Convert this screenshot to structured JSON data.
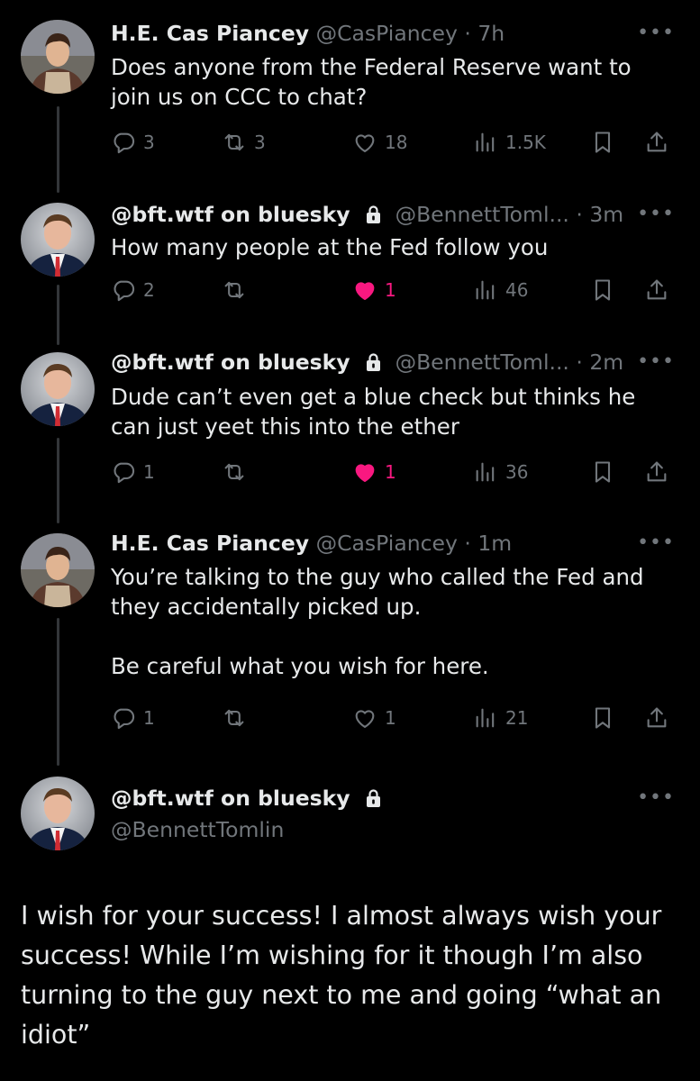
{
  "tweets": [
    {
      "name": "H.E. Cas Piancey",
      "handle": "@CasPiancey",
      "time": "· 7h",
      "text": "Does anyone from the Federal Reserve want to join us on CCC to chat?",
      "replies": "3",
      "reposts": "3",
      "likes": "18",
      "views": "1.5K",
      "liked": false,
      "avatar": "kid"
    },
    {
      "name": "@bft.wtf on bluesky",
      "handle": "@BennettToml...",
      "time": "· 3m",
      "text": "How many people at the Fed follow you",
      "replies": "2",
      "reposts": "",
      "likes": "1",
      "views": "46",
      "liked": true,
      "avatar": "suit"
    },
    {
      "name": "@bft.wtf on bluesky",
      "handle": "@BennettToml...",
      "time": "· 2m",
      "text": "Dude can’t even get a blue check but thinks he can just yeet this into the ether",
      "replies": "1",
      "reposts": "",
      "likes": "1",
      "views": "36",
      "liked": true,
      "avatar": "suit"
    },
    {
      "name": "H.E. Cas Piancey",
      "handle": "@CasPiancey",
      "time": "· 1m",
      "text": "You’re talking to the guy who called the Fed and they accidentally picked up.\n\nBe careful what you wish for here.",
      "replies": "1",
      "reposts": "",
      "likes": "1",
      "views": "21",
      "liked": false,
      "avatar": "kid"
    }
  ],
  "main_tweet": {
    "name": "@bft.wtf on bluesky",
    "handle": "@BennettTomlin",
    "text": "I wish for your success! I almost always wish your success! While I’m wishing for it though I’m also turning to the guy next to me and going “what an idiot”"
  },
  "more_label": "•••",
  "colors": {
    "background": "#000000",
    "text": "#e7e9ea",
    "muted": "#71767b",
    "like": "#f91880",
    "thread_line": "#333639"
  },
  "icons": [
    "reply-icon",
    "repost-icon",
    "like-icon",
    "views-icon",
    "bookmark-icon",
    "share-icon",
    "lock-icon",
    "more-icon"
  ]
}
